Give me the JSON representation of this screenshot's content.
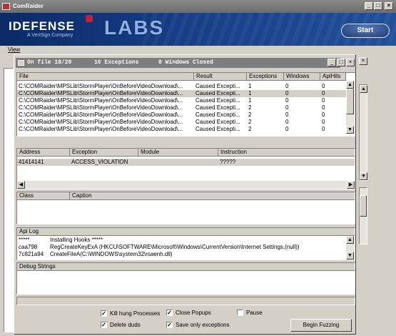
{
  "window": {
    "title": "ComRaider"
  },
  "banner": {
    "brand": "IDEFENSE",
    "brand_sub": "A VeriSign Company",
    "labs": "LABS",
    "start_label": "Start"
  },
  "menu": {
    "view_label": "View"
  },
  "child": {
    "status_file": "On file 18/20",
    "status_exceptions": "16 Exceptions",
    "status_windows": "0 Windows Closed"
  },
  "files_table": {
    "headers": [
      "File",
      "Result",
      "Exceptions",
      "Windows",
      "ApiHits"
    ],
    "rows": [
      [
        "C:\\COMRaider\\MPSLib\\StormPlayer\\OnBeforeVideoDownload\\...",
        "Caused Excepti...",
        "1",
        "0",
        "0"
      ],
      [
        "C:\\COMRaider\\MPSLib\\StormPlayer\\OnBeforeVideoDownload\\...",
        "Caused Excepti...",
        "1",
        "0",
        "0"
      ],
      [
        "C:\\COMRaider\\MPSLib\\StormPlayer\\OnBeforeVideoDownload\\...",
        "Caused Excepti...",
        "1",
        "0",
        "0"
      ],
      [
        "C:\\COMRaider\\MPSLib\\StormPlayer\\OnBeforeVideoDownload\\...",
        "Caused Excepti...",
        "2",
        "0",
        "0"
      ],
      [
        "C:\\COMRaider\\MPSLib\\StormPlayer\\OnBeforeVideoDownload\\...",
        "Caused Excepti...",
        "2",
        "0",
        "0"
      ],
      [
        "C:\\COMRaider\\MPSLib\\StormPlayer\\OnBeforeVideoDownload\\...",
        "Caused Excepti...",
        "2",
        "0",
        "0"
      ],
      [
        "C:\\COMRaider\\MPSLib\\StormPlayer\\OnBeforeVideoDownload\\...",
        "Caused Excepti...",
        "2",
        "0",
        "0"
      ]
    ]
  },
  "exceptions_table": {
    "headers": [
      "Address",
      "Exception",
      "Module",
      "Instruction"
    ],
    "rows": [
      [
        "41414141",
        "ACCESS_VIOLATION",
        "",
        "?????"
      ]
    ]
  },
  "windows_table": {
    "headers": [
      "Class",
      "Caption"
    ]
  },
  "api_log": {
    "title": "Api Log",
    "lines": [
      [
        "*****",
        "Installing Hooks *****"
      ],
      [
        "caa798",
        "RegCreateKeyExA (HKCU\\SOFTWARE\\Microsoft\\Windows\\CurrentVersion\\Internet Settings,(null))"
      ],
      [
        "7c821a94",
        "CreateFileA(C:\\WINDOWS\\system32\\rsaenh.dll)"
      ]
    ]
  },
  "debug": {
    "title": "Debug Strings"
  },
  "options": {
    "kill_hung": {
      "label": "Kill hung Processes",
      "checked": true
    },
    "close_popups": {
      "label": "Close Popups",
      "checked": true
    },
    "pause": {
      "label": "Pause",
      "checked": false
    },
    "delete_duds": {
      "label": "Delete duds",
      "checked": true
    },
    "save_only": {
      "label": "Save only exceptions",
      "checked": true
    },
    "begin_label": "Begin Fuzzing"
  }
}
